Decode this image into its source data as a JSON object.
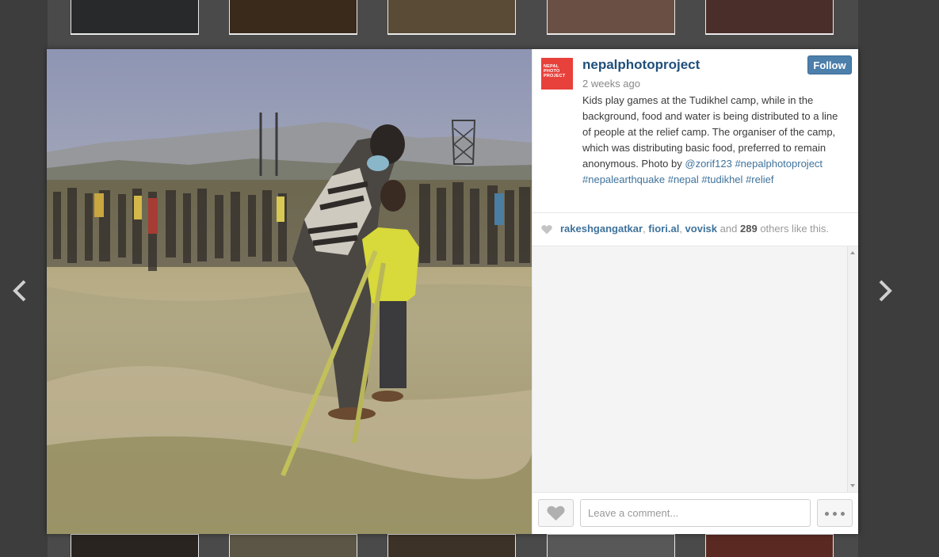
{
  "post": {
    "username": "nepalphotoproject",
    "avatar_text": [
      "NEPAL",
      "PHOTO",
      "PROJECT"
    ],
    "timestamp": "2 weeks ago",
    "follow_label": "Follow",
    "caption_text": "Kids play games at the Tudikhel camp, while in the background, food and water is being distributed to a line of people at the relief camp. The organiser of the camp, which was distributing basic food, preferred to remain anonymous. Photo by",
    "caption_mention": "@zorif123",
    "hashtags": [
      "#nepalphotoproject",
      "#nepalearthquake",
      "#nepal",
      "#tudikhel",
      "#relief"
    ]
  },
  "likes": {
    "users": [
      "rakeshgangatkar",
      "fiori.al",
      "vovisk"
    ],
    "and_label": "and",
    "others_count": "289",
    "suffix": "others like this."
  },
  "comment": {
    "placeholder": "Leave a comment..."
  },
  "icons": {
    "prev": "chevron-left-icon",
    "next": "chevron-right-icon",
    "like": "heart-icon",
    "more": "ellipsis-icon"
  },
  "colors": {
    "link": "#3f729b",
    "username": "#1f4f7a",
    "follow_button": "#4d7fab",
    "avatar": "#e8403b",
    "backdrop": "#3d3d3d"
  }
}
